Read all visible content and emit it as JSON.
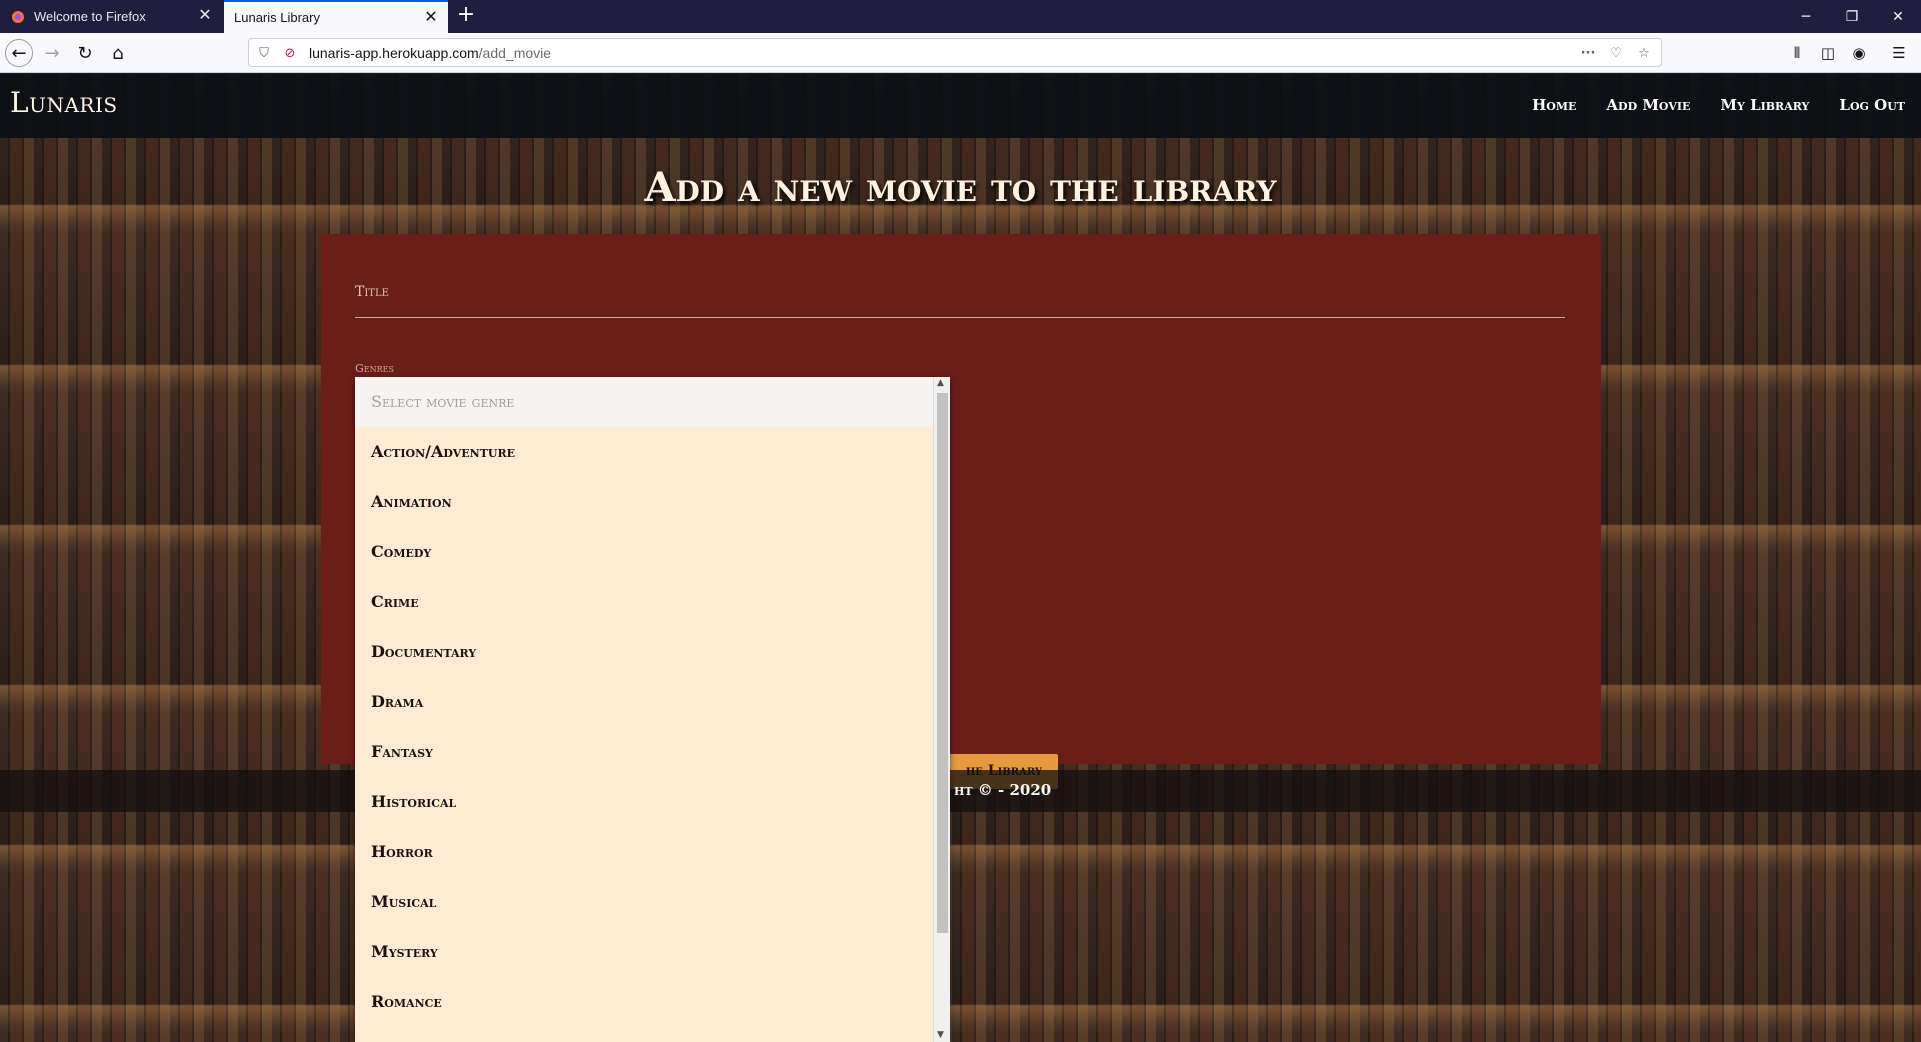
{
  "browser": {
    "tabs": [
      {
        "title": "Welcome to Firefox",
        "active": false
      },
      {
        "title": "Lunaris Library",
        "active": true
      }
    ],
    "url_host": "lunaris-app.herokuapp.com",
    "url_path": "/add_movie",
    "icons": [
      "back-icon",
      "forward-icon",
      "reload-icon",
      "home-icon",
      "shield-icon",
      "insecure-lock-icon",
      "more-icon",
      "pocket-icon",
      "bookmark-star-icon",
      "library-icon",
      "sidebar-icon",
      "account-icon",
      "menu-icon"
    ]
  },
  "site": {
    "brand": "Lunaris",
    "nav": [
      "Home",
      "Add Movie",
      "My Library",
      "Log Out"
    ]
  },
  "main": {
    "heading": "Add a new movie to the library",
    "title_label": "Title",
    "genres_label": "Genres",
    "submit_visible_text": "he library",
    "footer_visible_text": "ht © - 2020"
  },
  "genre_dropdown": {
    "placeholder": "Select movie genre",
    "options": [
      "Action/Adventure",
      "Animation",
      "Comedy",
      "Crime",
      "Documentary",
      "Drama",
      "Fantasy",
      "Historical",
      "Horror",
      "Musical",
      "Mystery",
      "Romance"
    ]
  },
  "colors": {
    "panel": "#6b1e19",
    "button": "#e59a3e",
    "dropdown_bg": "#fdebd3",
    "header_bg": "#0a0e14"
  }
}
